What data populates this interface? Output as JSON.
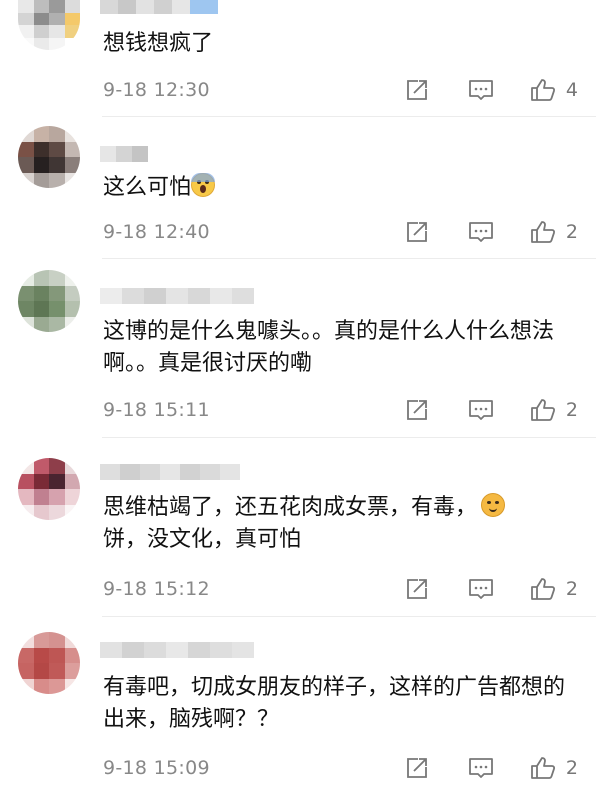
{
  "comments": [
    {
      "text": "想钱想疯了",
      "emoji": "",
      "time": "9-18 12:30",
      "likes": "4"
    },
    {
      "text": "这么可怕",
      "emoji": "scream-emoji",
      "time": "9-18 12:40",
      "likes": "2"
    },
    {
      "text": "这博的是什么鬼噱头。。真的是什么人什么想法啊。。真是很讨厌的嘞",
      "emoji": "",
      "time": "9-18 15:11",
      "likes": "2"
    },
    {
      "text_before": "思维枯竭了，还五花肉成女票，有毒，",
      "emoji": "cat-emoji",
      "text_after": "饼，没文化，真可怕",
      "time": "9-18 15:12",
      "likes": "2"
    },
    {
      "text": "有毒吧，切成女朋友的样子，这样的广告都想的出来，脑残啊？？",
      "emoji": "",
      "time": "9-18 15:09",
      "likes": "2"
    }
  ],
  "icons": {
    "repost": "repost-icon",
    "comment": "comment-icon",
    "like": "like-icon"
  },
  "colors": {
    "text": "#111111",
    "meta": "#888888",
    "icon": "#777777"
  }
}
